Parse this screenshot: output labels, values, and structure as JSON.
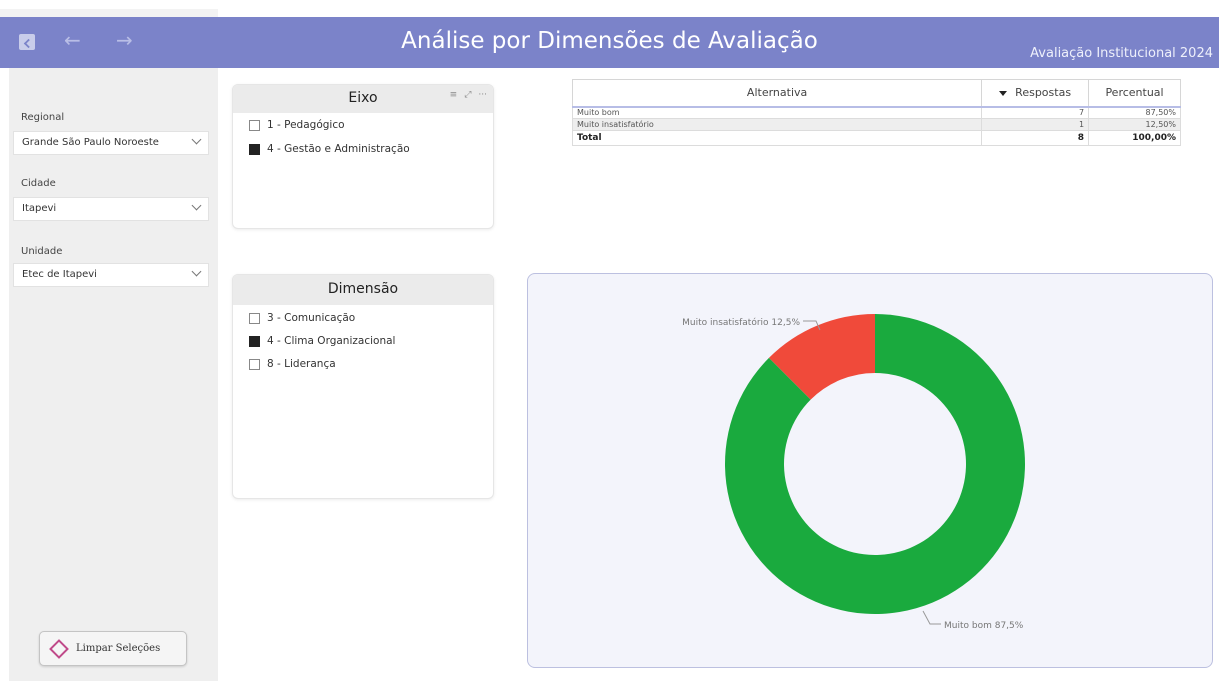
{
  "header": {
    "title": "Análise por Dimensões de Avaliação",
    "subtitle": "Avaliação Institucional 2024",
    "back_arrow": "←",
    "forward_arrow": "→"
  },
  "filters": {
    "regional": {
      "label": "Regional",
      "value": "Grande São Paulo Noroeste"
    },
    "cidade": {
      "label": "Cidade",
      "value": "Itapevi"
    },
    "unidade": {
      "label": "Unidade",
      "value": "Etec de Itapevi"
    }
  },
  "clear_button": {
    "label": "Limpar Seleções"
  },
  "eixo": {
    "title": "Eixo",
    "items": [
      {
        "label": "1 - Pedagógico",
        "checked": false
      },
      {
        "label": "4 - Gestão e Administração",
        "checked": true
      }
    ]
  },
  "dimensao": {
    "title": "Dimensão",
    "items": [
      {
        "label": "3 - Comunicação",
        "checked": false
      },
      {
        "label": "4 - Clima Organizacional",
        "checked": true
      },
      {
        "label": "8 - Liderança",
        "checked": false
      }
    ]
  },
  "table": {
    "headers": [
      "Alternativa",
      "Respostas",
      "Percentual"
    ],
    "rows": [
      {
        "alternativa": "Muito bom",
        "respostas": "7",
        "percentual": "87,50%"
      },
      {
        "alternativa": "Muito insatisfatório",
        "respostas": "1",
        "percentual": "12,50%"
      }
    ],
    "total": {
      "label": "Total",
      "respostas": "8",
      "percentual": "100,00%"
    }
  },
  "chart_data": {
    "type": "pie",
    "subtype": "donut",
    "categories": [
      "Muito bom",
      "Muito insatisfatório"
    ],
    "values": [
      87.5,
      12.5
    ],
    "labels": [
      "Muito bom 87,5%",
      "Muito insatisfatório 12,5%"
    ],
    "colors": [
      "#1aaa3e",
      "#f04a3a"
    ]
  },
  "colors": {
    "header_bg": "#7b83c9",
    "panel_bg": "#efefef",
    "chart_bg": "#f3f4fb"
  }
}
